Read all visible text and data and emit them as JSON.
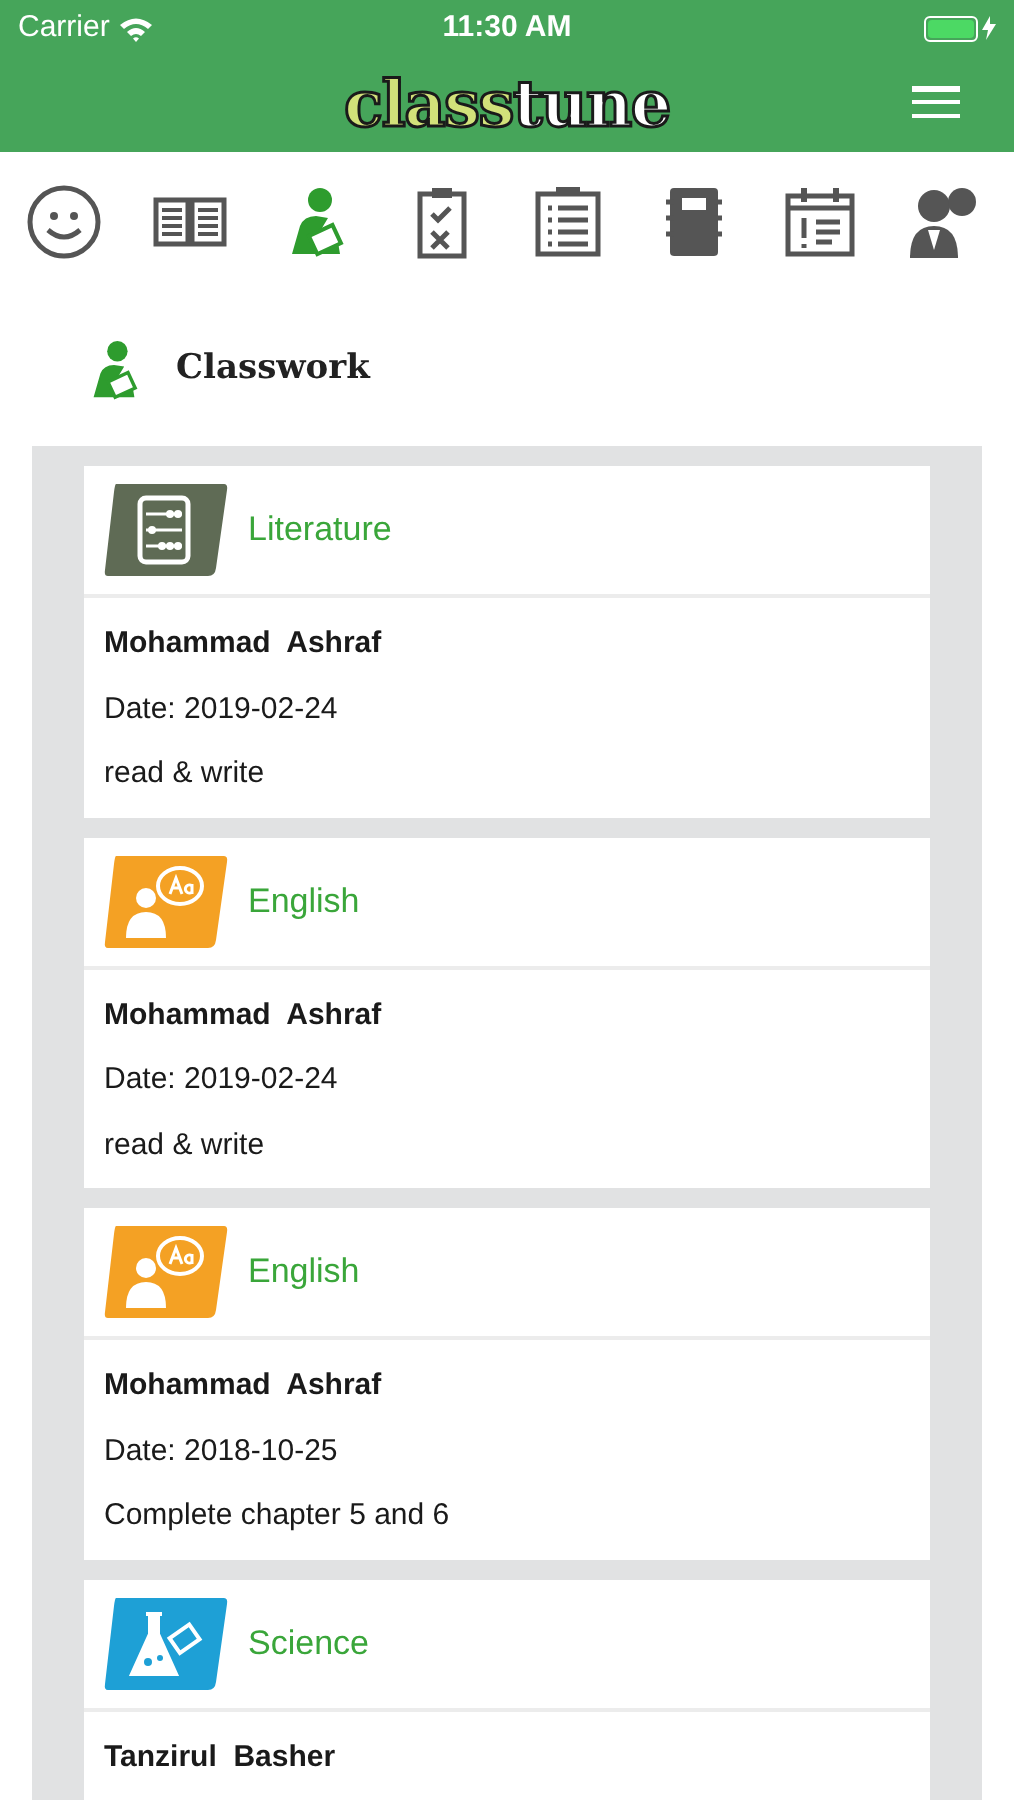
{
  "status_bar": {
    "carrier": "Carrier",
    "time": "11:30 AM"
  },
  "header": {
    "logo": [
      {
        "text": "class",
        "color": "#d2e27a"
      },
      {
        "text": "tune",
        "color": "#ffffff"
      }
    ]
  },
  "nav": [
    {
      "kind": "smiley",
      "selected": false
    },
    {
      "kind": "book",
      "selected": false
    },
    {
      "kind": "classwork",
      "selected": true
    },
    {
      "kind": "checklist",
      "selected": false
    },
    {
      "kind": "list",
      "selected": false
    },
    {
      "kind": "notebook",
      "selected": false
    },
    {
      "kind": "calendar",
      "selected": false
    },
    {
      "kind": "people",
      "selected": false
    }
  ],
  "section": {
    "title": "Classwork"
  },
  "cards": [
    {
      "subject": "Literature",
      "kind": "abacus",
      "color": "#5f6b55",
      "teacher": "Mohammad  Ashraf",
      "date": "Date: 2019-02-24",
      "note": "read & write"
    },
    {
      "subject": "English",
      "kind": "language",
      "color": "#f4a124",
      "teacher": "Mohammad  Ashraf",
      "date": "Date: 2019-02-24",
      "note": "read & write"
    },
    {
      "subject": "English",
      "kind": "language",
      "color": "#f4a124",
      "teacher": "Mohammad  Ashraf",
      "date": "Date: 2018-10-25",
      "note": "Complete chapter 5 and 6"
    },
    {
      "subject": "Science",
      "kind": "flask",
      "color": "#1ea0d6",
      "teacher": "Tanzirul  Basher"
    }
  ]
}
